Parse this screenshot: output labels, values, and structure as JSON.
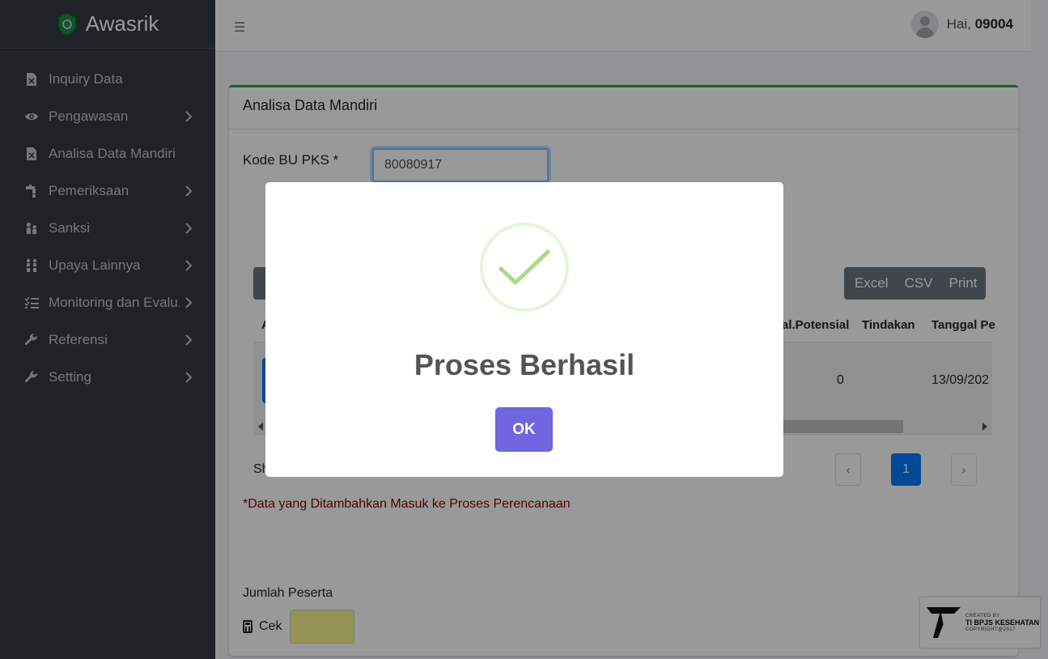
{
  "brand": {
    "name": "Awasrik"
  },
  "sidebar": {
    "items": [
      {
        "label": "Inquiry Data",
        "icon": "file-excel-icon",
        "has_children": false
      },
      {
        "label": "Pengawasan",
        "icon": "eye-icon",
        "has_children": true
      },
      {
        "label": "Analisa Data Mandiri",
        "icon": "file-excel-icon",
        "has_children": false
      },
      {
        "label": "Pemeriksaan",
        "icon": "faucet-icon",
        "has_children": true
      },
      {
        "label": "Sanksi",
        "icon": "people-icon",
        "has_children": true
      },
      {
        "label": "Upaya Lainnya",
        "icon": "group-icon",
        "has_children": true
      },
      {
        "label": "Monitoring dan Evalu...",
        "icon": "tasks-icon",
        "has_children": true
      },
      {
        "label": "Referensi",
        "icon": "wrench-icon",
        "has_children": true
      },
      {
        "label": "Setting",
        "icon": "wrench-icon",
        "has_children": true
      }
    ]
  },
  "topbar": {
    "menu_icon": "hamburger-icon",
    "greeting": "Hai, ",
    "user_id": "09004"
  },
  "card": {
    "title": "Analisa Data Mandiri",
    "form": {
      "label": "Kode BU PKS *",
      "value": "80080917"
    },
    "export_buttons": [
      "Excel",
      "CSV",
      "Print"
    ],
    "table": {
      "headers_visible": [
        "A",
        "al.Potensial",
        "Tindakan",
        "Tanggal Pe"
      ],
      "row": {
        "potensial": "",
        "tindakan": "0",
        "tanggal": "13/09/202"
      }
    },
    "show_info": "Sh",
    "pagination": {
      "prev": "‹",
      "current": "1",
      "next": "›"
    },
    "note": "*Data yang Ditambahkan Masuk ke Proses Perencanaan",
    "jumlah_label": "Jumlah Peserta",
    "cek_label": "Cek"
  },
  "watermark": {
    "line1": "CREATED BY",
    "line2": "TI BPJS KESEHATAN",
    "line3": "COPYRIGHT@2017"
  },
  "modal": {
    "icon": "success-check-icon",
    "title": "Proses Berhasil",
    "ok_label": "OK"
  },
  "colors": {
    "sidebar_bg": "#343a40",
    "card_accent": "#28a745",
    "ok_button": "#7066e0",
    "success_check": "#a5dc86",
    "primary": "#007bff"
  }
}
